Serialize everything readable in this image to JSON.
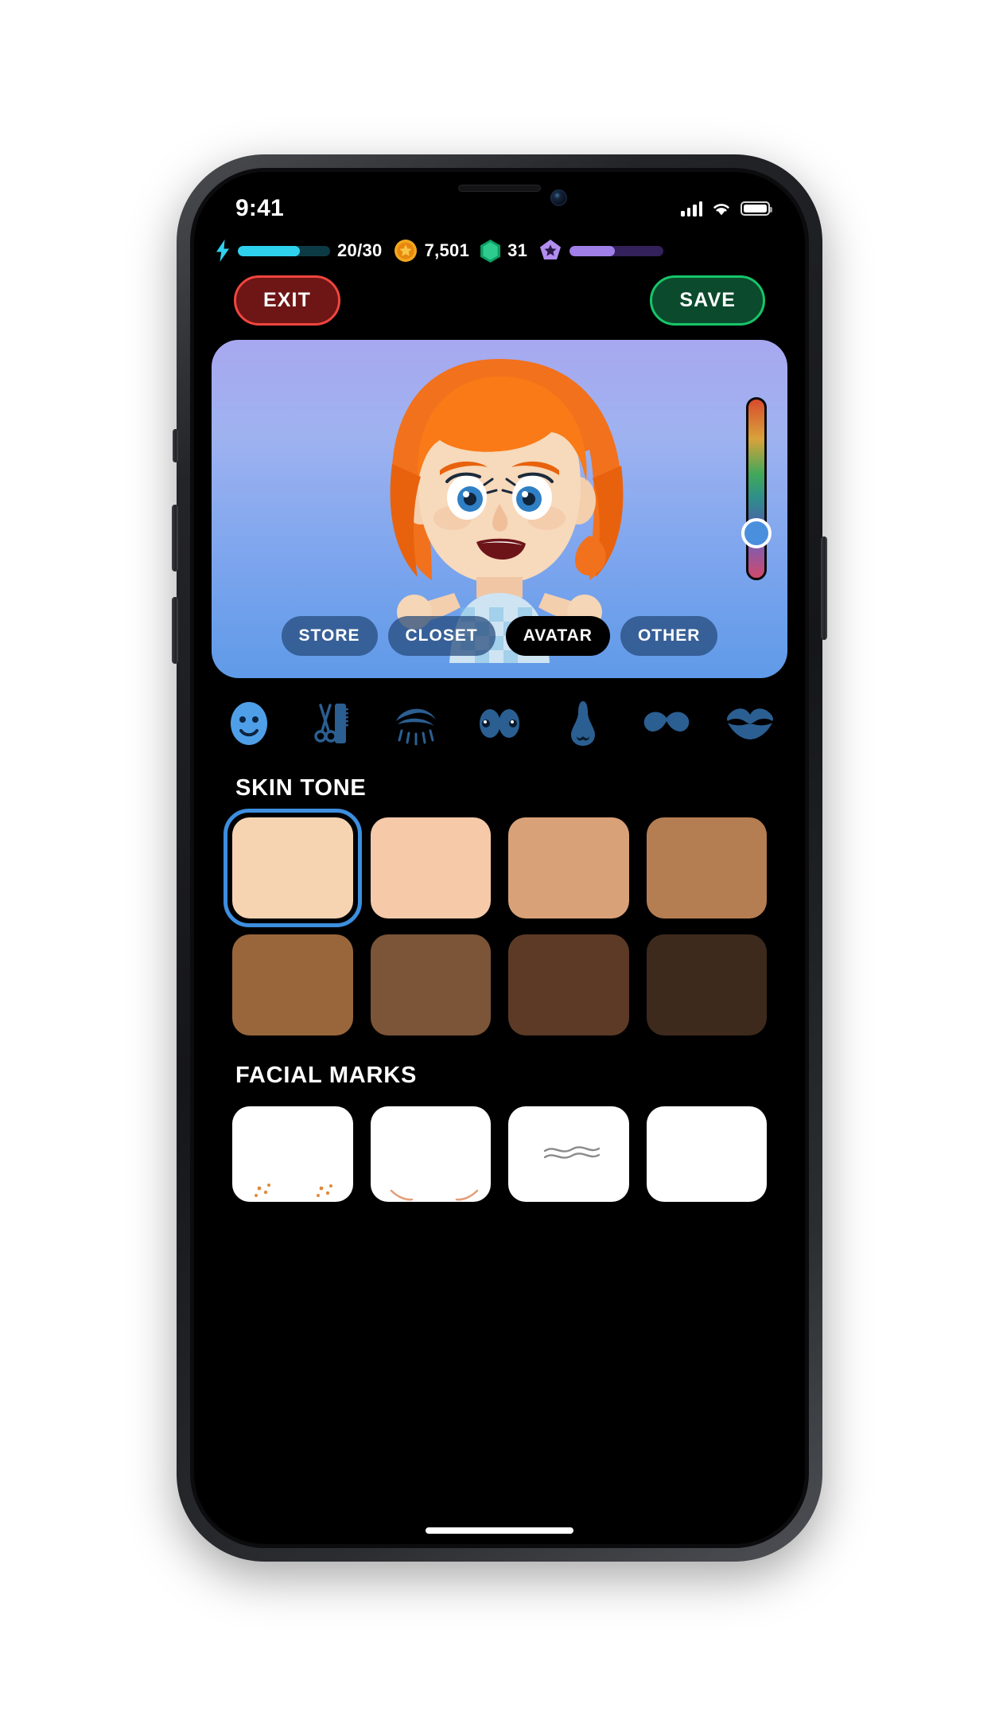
{
  "status_bar": {
    "time": "9:41",
    "signal_icon": "cellular-bars-icon",
    "wifi_icon": "wifi-icon",
    "battery_icon": "battery-full-icon"
  },
  "resource_bar": {
    "energy": {
      "icon": "lightning-bolt-icon",
      "value": "20/30",
      "current": 20,
      "max": 30,
      "fill_percent": 67,
      "bar_color": "#2fd2ee",
      "track_color": "#0d3b45"
    },
    "coins": {
      "icon": "coin-star-icon",
      "value": "7,501",
      "color": "#f2a81d"
    },
    "gems": {
      "icon": "gem-icon",
      "value": "31",
      "color": "#11a86b"
    },
    "pass": {
      "icon": "star-badge-icon",
      "fill_percent": 48,
      "bar_color": "#a07fe8",
      "track_color": "#33215c"
    }
  },
  "actions": {
    "exit_label": "EXIT",
    "exit_color": "#f0453f",
    "save_label": "SAVE",
    "save_color": "#16c56a"
  },
  "preview": {
    "hue_slider": {
      "name": "color-hue-slider",
      "handle_color": "#4a8fdd",
      "handle_position_percent": 63
    }
  },
  "tabs": [
    {
      "label": "STORE",
      "active": false
    },
    {
      "label": "CLOSET",
      "active": false
    },
    {
      "label": "AVATAR",
      "active": true
    },
    {
      "label": "OTHER",
      "active": false
    }
  ],
  "feature_icons": [
    {
      "name": "face-icon",
      "label": "Face",
      "active": true
    },
    {
      "name": "hair-icon",
      "label": "Hair",
      "active": false
    },
    {
      "name": "eyebrow-icon",
      "label": "Eyebrows",
      "active": false
    },
    {
      "name": "eyes-icon",
      "label": "Eyes",
      "active": false
    },
    {
      "name": "nose-icon",
      "label": "Nose",
      "active": false
    },
    {
      "name": "mustache-icon",
      "label": "Mustache",
      "active": false
    },
    {
      "name": "lips-icon",
      "label": "Lips",
      "active": false
    }
  ],
  "skin_tone": {
    "title": "SKIN TONE",
    "selected_index": 0,
    "selection_color": "#3d8ede",
    "swatches": [
      {
        "color": "#f6d4b2"
      },
      {
        "color": "#f6c9a8"
      },
      {
        "color": "#d9a178"
      },
      {
        "color": "#b57d52"
      },
      {
        "color": "#99663c"
      },
      {
        "color": "#7c5437"
      },
      {
        "color": "#5c3a26"
      },
      {
        "color": "#3d2a1d"
      }
    ]
  },
  "facial_marks": {
    "title": "FACIAL MARKS",
    "items": [
      {
        "name": "freckles-mark",
        "selected": false
      },
      {
        "name": "blush-mark",
        "selected": false
      },
      {
        "name": "wrinkles-mark",
        "selected": false
      },
      {
        "name": "none-mark",
        "selected": false
      }
    ]
  }
}
